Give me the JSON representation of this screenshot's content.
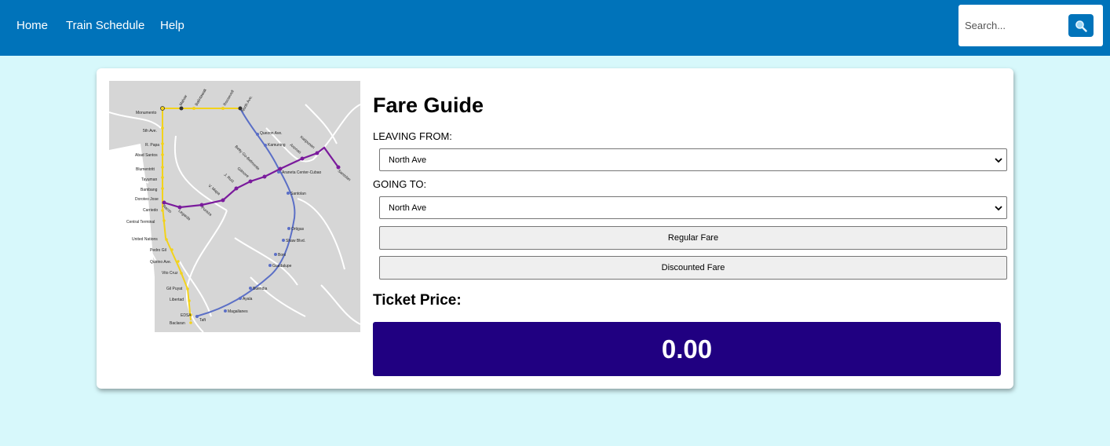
{
  "nav": {
    "links": [
      "Home",
      "Train Schedule",
      "Help"
    ],
    "search_placeholder": "Search...",
    "search_icon": "search-icon"
  },
  "fare": {
    "title": "Fare Guide",
    "leaving_label": "LEAVING FROM:",
    "leaving_value": "North Ave",
    "going_label": "GOING TO:",
    "going_value": "North Ave",
    "regular_button": "Regular Fare",
    "discounted_button": "Discounted Fare",
    "ticket_label": "Ticket Price:",
    "price": "0.00"
  },
  "map": {
    "colors": {
      "yellow_line": "#f2d21b",
      "blue_line": "#5b6fc6",
      "purple_line": "#7a1a9c",
      "land": "#d6d6d6",
      "water": "#ffffff"
    },
    "yellow_stations": [
      "Monumento",
      "5th Ave.",
      "R. Papa",
      "Abad Santos",
      "Blumentritt",
      "Tayuman",
      "Bambang",
      "Doroteo Jose",
      "Carriedo",
      "Central Terminal",
      "United Nations",
      "Pedro Gil",
      "Quirino Ave.",
      "Vito Cruz",
      "Gil Puyat",
      "Libertad",
      "EDSA",
      "Baclaran"
    ],
    "top_stations": [
      "Malvar",
      "Balintawak",
      "Roosevelt",
      "North Ave."
    ],
    "blue_stations": [
      "Quezon Ave.",
      "Kamuning",
      "Araneta Center-Cubao",
      "Santolan",
      "Ortigas",
      "Shaw Blvd.",
      "Boni",
      "Guadalupe",
      "Buendia",
      "Ayala",
      "Magallanes",
      "Taft"
    ],
    "purple_stations": [
      "Recto",
      "Legarda",
      "Pureza",
      "V. Mapa",
      "J. Ruiz",
      "Gilmore",
      "Betty Go-Belmonte",
      "Anonas",
      "Katipunan",
      "Santolan"
    ]
  }
}
